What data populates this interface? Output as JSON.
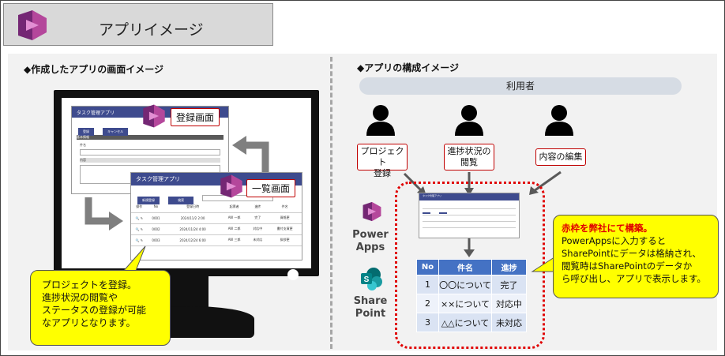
{
  "header": {
    "title": "アプリイメージ"
  },
  "left": {
    "section_title": "◆作成したアプリの画面イメージ",
    "reg_app": {
      "title": "タスク管理アプリ",
      "btn_register": "登録",
      "btn_cancel": "キャンセル",
      "group": "基本情報",
      "field1": "件名",
      "field2": "内容"
    },
    "list_app": {
      "title": "タスク管理アプリ",
      "btn_new": "新規登録",
      "btn_search": "検索",
      "filter_text": "",
      "headers": [
        "操作",
        "No",
        "登録日時",
        "起票者",
        "進捗",
        "件名"
      ],
      "rows": [
        [
          "0001",
          "2024/11/2 2:00",
          "AW 一郎",
          "完了",
          "資格更"
        ],
        [
          "0002",
          "2024/11/24 4:00",
          "AW 二郎",
          "対応中",
          "書付支資更"
        ],
        [
          "0003",
          "2024/12/24 6:00",
          "AW 三郎",
          "未対応",
          "挨拶更"
        ]
      ]
    },
    "label_register": "登録画面",
    "label_list": "一覧画面",
    "callout_lines": [
      "プロジェクトを登録。",
      "進捗状況の閲覧や",
      "ステータスの登録が可能",
      "なアプリとなります。"
    ]
  },
  "right": {
    "section_title": "◆アプリの構成イメージ",
    "users_label": "利用者",
    "actions": [
      {
        "line1": "プロジェクト",
        "line2": "登録"
      },
      {
        "line1": "進捗状況の",
        "line2": "閲覧"
      },
      {
        "line1": "内容の編集",
        "line2": ""
      }
    ],
    "powerapps_label": [
      "Power",
      "Apps"
    ],
    "sharepoint_label": [
      "Share",
      "Point"
    ],
    "mini_app_title": "タスク管理アプリ",
    "table": {
      "headers": [
        "No",
        "件名",
        "進捗"
      ],
      "rows": [
        [
          "1",
          "〇〇について",
          "完了"
        ],
        [
          "2",
          "××について",
          "対応中"
        ],
        [
          "3",
          "△△について",
          "未対応"
        ]
      ]
    },
    "callout": {
      "title": "赤枠を弊社にて構築。",
      "lines": [
        "PowerAppsに入力すると",
        "SharePointにデータは格納され、",
        "閲覧時はSharePointのデータか",
        "ら呼び出し、アプリで表示します。"
      ]
    }
  },
  "colors": {
    "accent_red": "#c00000",
    "app_bar": "#3e4b8e",
    "callout_yellow": "#ffff00",
    "table_header": "#4472c4"
  }
}
